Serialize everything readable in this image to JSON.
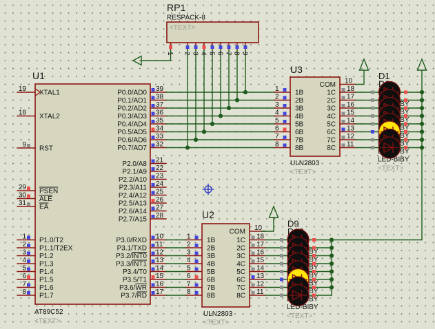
{
  "colors": {
    "bg": "#e0e2d3",
    "grid_dot": "#6a6d58",
    "body": "#d7d7c0",
    "outline": "#8c1612",
    "wire": "#1d5c1d",
    "text": "#141414",
    "ghost": "#9c9d8f",
    "blue": "#4447dd",
    "red": "#f04e4e",
    "gray": "#8f8f8f",
    "led_off": "#0f0f0f",
    "led_on": "#ffe70a",
    "led_symbol": "#7c1010",
    "origin": "#2a35c0"
  },
  "rp1": {
    "ref": "RP1",
    "value": "RESPACK-8",
    "placeholder": "<TEXT>",
    "pins": [
      {
        "num": "1",
        "state": "red"
      },
      {
        "num": "2",
        "state": "blue"
      },
      {
        "num": "3",
        "state": "blue"
      },
      {
        "num": "4",
        "state": "red"
      },
      {
        "num": "5",
        "state": "blue"
      },
      {
        "num": "6",
        "state": "blue"
      },
      {
        "num": "7",
        "state": "blue"
      },
      {
        "num": "8",
        "state": "blue"
      },
      {
        "num": "9",
        "state": "blue"
      }
    ]
  },
  "u1": {
    "ref": "U1",
    "value": "AT89C52",
    "placeholder": "<TEXT>",
    "left_pins": [
      {
        "num": "19",
        "pre": "XTAL1",
        "bar": "",
        "state": ""
      },
      {
        "num": "18",
        "pre": "XTAL2",
        "bar": "",
        "state": ""
      },
      {
        "num": "9",
        "pre": "RST",
        "bar": "",
        "state": "gray"
      },
      {
        "num": "29",
        "pre": "",
        "bar": "PSEN",
        "state": "red"
      },
      {
        "num": "30",
        "pre": "",
        "bar": "ALE",
        "state": "red"
      },
      {
        "num": "31",
        "pre": "",
        "bar": "EA",
        "state": "gray"
      },
      {
        "num": "1",
        "pre": "P1.0/T2",
        "bar": "",
        "state": "blue"
      },
      {
        "num": "2",
        "pre": "P1.1/T2EX",
        "bar": "",
        "state": "blue"
      },
      {
        "num": "3",
        "pre": "P1.2",
        "bar": "",
        "state": "blue"
      },
      {
        "num": "4",
        "pre": "P1.3",
        "bar": "",
        "state": "blue"
      },
      {
        "num": "5",
        "pre": "P1.4",
        "bar": "",
        "state": "blue"
      },
      {
        "num": "6",
        "pre": "P1.5",
        "bar": "",
        "state": "red"
      },
      {
        "num": "7",
        "pre": "P1.6",
        "bar": "",
        "state": "blue"
      },
      {
        "num": "8",
        "pre": "P1.7",
        "bar": "",
        "state": "blue"
      }
    ],
    "p0": [
      {
        "num": "39",
        "pre": "P0.0/AD0",
        "bar": "",
        "state": "blue"
      },
      {
        "num": "38",
        "pre": "P0.1/AD1",
        "bar": "",
        "state": "blue"
      },
      {
        "num": "37",
        "pre": "P0.2/AD2",
        "bar": "",
        "state": "blue"
      },
      {
        "num": "36",
        "pre": "P0.3/AD3",
        "bar": "",
        "state": "blue"
      },
      {
        "num": "35",
        "pre": "P0.4/AD4",
        "bar": "",
        "state": "blue"
      },
      {
        "num": "34",
        "pre": "P0.5/AD5",
        "bar": "",
        "state": "red"
      },
      {
        "num": "33",
        "pre": "P0.6/AD6",
        "bar": "",
        "state": "blue"
      },
      {
        "num": "32",
        "pre": "P0.7/AD7",
        "bar": "",
        "state": "blue"
      }
    ],
    "p2": [
      {
        "num": "21",
        "pre": "P2.0/A8",
        "bar": "",
        "state": "blue"
      },
      {
        "num": "22",
        "pre": "P2.1/A9",
        "bar": "",
        "state": "blue"
      },
      {
        "num": "23",
        "pre": "P2.2/A10",
        "bar": "",
        "state": "blue"
      },
      {
        "num": "24",
        "pre": "P2.3/A11",
        "bar": "",
        "state": "blue"
      },
      {
        "num": "25",
        "pre": "P2.4/A12",
        "bar": "",
        "state": "blue"
      },
      {
        "num": "26",
        "pre": "P2.5/A13",
        "bar": "",
        "state": "red"
      },
      {
        "num": "27",
        "pre": "P2.6/A14",
        "bar": "",
        "state": "blue"
      },
      {
        "num": "28",
        "pre": "P2.7/A15",
        "bar": "",
        "state": "blue"
      }
    ],
    "p3": [
      {
        "num": "10",
        "pre": "P3.0/RXD",
        "bar": "",
        "state": "blue"
      },
      {
        "num": "11",
        "pre": "P3.1/TXD",
        "bar": "",
        "state": "blue"
      },
      {
        "num": "12",
        "pre": "P3.2/",
        "bar": "INT0",
        "state": "blue"
      },
      {
        "num": "13",
        "pre": "P3.3/",
        "bar": "INT1",
        "state": "blue"
      },
      {
        "num": "14",
        "pre": "P3.4/T0",
        "bar": "",
        "state": "blue"
      },
      {
        "num": "15",
        "pre": "P3.5/T1",
        "bar": "",
        "state": "red"
      },
      {
        "num": "16",
        "pre": "P3.6/",
        "bar": "WR",
        "state": "blue"
      },
      {
        "num": "17",
        "pre": "P3.7/",
        "bar": "RD",
        "state": "blue"
      }
    ]
  },
  "u3": {
    "ref": "U3",
    "value": "ULN2803",
    "placeholder": "<TEXT>",
    "com_num": "10",
    "com_name": "COM",
    "inputs": [
      {
        "num": "1",
        "name": "1B",
        "state": "blue"
      },
      {
        "num": "2",
        "name": "2B",
        "state": "blue"
      },
      {
        "num": "3",
        "name": "3B",
        "state": "blue"
      },
      {
        "num": "4",
        "name": "4B",
        "state": "blue"
      },
      {
        "num": "5",
        "name": "5B",
        "state": "blue"
      },
      {
        "num": "6",
        "name": "6B",
        "state": "red"
      },
      {
        "num": "7",
        "name": "7B",
        "state": "blue"
      },
      {
        "num": "8",
        "name": "8B",
        "state": "blue"
      }
    ],
    "outputs": [
      {
        "num": "18",
        "name": "1C",
        "state": "gray"
      },
      {
        "num": "17",
        "name": "2C",
        "state": "gray"
      },
      {
        "num": "16",
        "name": "3C",
        "state": "gray"
      },
      {
        "num": "15",
        "name": "4C",
        "state": "gray"
      },
      {
        "num": "14",
        "name": "5C",
        "state": "gray"
      },
      {
        "num": "13",
        "name": "6C",
        "state": "blue"
      },
      {
        "num": "12",
        "name": "7C",
        "state": "gray"
      },
      {
        "num": "11",
        "name": "8C",
        "state": "gray"
      }
    ]
  },
  "u2": {
    "ref": "U2",
    "value": "ULN2803",
    "placeholder": "<TEXT>",
    "com_num": "10",
    "com_name": "COM",
    "inputs": [
      {
        "num": "1",
        "name": "1B",
        "state": "blue"
      },
      {
        "num": "2",
        "name": "2B",
        "state": "blue"
      },
      {
        "num": "3",
        "name": "3B",
        "state": "blue"
      },
      {
        "num": "4",
        "name": "4B",
        "state": "blue"
      },
      {
        "num": "5",
        "name": "5B",
        "state": "blue"
      },
      {
        "num": "6",
        "name": "6B",
        "state": "red"
      },
      {
        "num": "7",
        "name": "7B",
        "state": "blue"
      },
      {
        "num": "8",
        "name": "8B",
        "state": "blue"
      }
    ],
    "outputs": [
      {
        "num": "18",
        "name": "1C",
        "state": "gray"
      },
      {
        "num": "17",
        "name": "2C",
        "state": "gray"
      },
      {
        "num": "16",
        "name": "3C",
        "state": "gray"
      },
      {
        "num": "15",
        "name": "4C",
        "state": "gray"
      },
      {
        "num": "14",
        "name": "5C",
        "state": "gray"
      },
      {
        "num": "13",
        "name": "6C",
        "state": "blue"
      },
      {
        "num": "12",
        "name": "7C",
        "state": "gray"
      },
      {
        "num": "11",
        "name": "8C",
        "state": "gray"
      }
    ]
  },
  "led_top": {
    "ref": "D1",
    "ref_behind": "D2",
    "model": "LED-BIBY",
    "placeholder": "<TEXT>",
    "states": [
      "off",
      "off",
      "off",
      "off",
      "off",
      "on",
      "off",
      "off"
    ],
    "anode_states": [
      "gray",
      "gray",
      "gray",
      "gray",
      "gray",
      "blue",
      "gray",
      "gray"
    ],
    "cathode_states": [
      "red",
      "red",
      "red",
      "red",
      "red",
      "red",
      "red",
      "red"
    ]
  },
  "led_bottom": {
    "ref": "D9",
    "ref_behind": "D10",
    "model": "LED-BIBY",
    "placeholder": "<TEXT>",
    "states": [
      "off",
      "off",
      "off",
      "off",
      "off",
      "on",
      "off",
      "off"
    ],
    "anode_states": [
      "gray",
      "gray",
      "gray",
      "gray",
      "gray",
      "blue",
      "gray",
      "gray"
    ],
    "cathode_states": [
      "red",
      "red",
      "red",
      "red",
      "red",
      "red",
      "red",
      "red"
    ]
  }
}
